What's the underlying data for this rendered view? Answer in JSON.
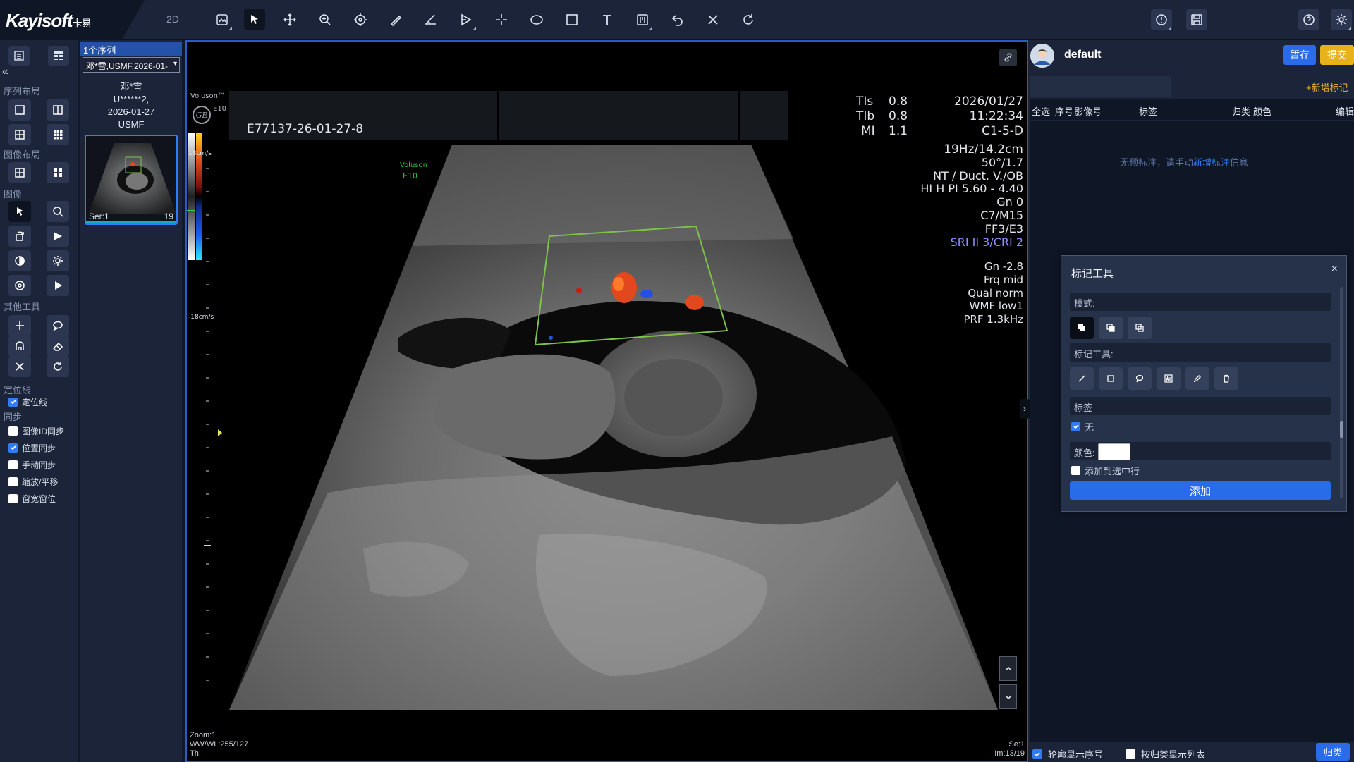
{
  "app": {
    "brand": "Kayisoft",
    "brand_cn": "卡易",
    "mode": "2D"
  },
  "toolbar": {
    "tools": [
      "image-view-icon",
      "pointer-icon",
      "pan-icon",
      "zoom-icon",
      "magnify-icon",
      "length-icon",
      "angle-icon",
      "arrow-icon",
      "crosshair-icon",
      "ellipse-icon",
      "rectangle-icon",
      "text-icon",
      "ruler-icon",
      "undo-icon",
      "delete-icon",
      "reset-icon"
    ],
    "right_tools": [
      "info-icon",
      "save-icon",
      "help-icon",
      "settings-icon"
    ]
  },
  "left_panel": {
    "series_layout_label": "序列布局",
    "image_layout_label": "图像布局",
    "image_label": "图像",
    "other_tools_label": "其他工具",
    "locator_section_label": "定位线",
    "locator_checkbox": "定位线",
    "sync_label": "同步",
    "sync_options": [
      {
        "label": "图像ID同步",
        "checked": false
      },
      {
        "label": "位置同步",
        "checked": true
      },
      {
        "label": "手动同步",
        "checked": false
      },
      {
        "label": "缩放/平移",
        "checked": false
      },
      {
        "label": "窗宽窗位",
        "checked": false
      }
    ]
  },
  "series_panel": {
    "tab": "1个序列",
    "select_value": "邓*雪,USMF,2026-01-",
    "patient_name": "邓*雪",
    "patient_id": "U******2,",
    "study_date": "2026-01-27",
    "modality": "USMF",
    "thumb_series": "Ser:1",
    "thumb_count": "19"
  },
  "viewport": {
    "device": "Voluson™",
    "device_model": "E10",
    "study_id": "E77137-26-01-27-8",
    "tis_label": "TIs",
    "tis_value": "0.8",
    "tib_label": "TIb",
    "tib_value": "0.8",
    "mi_label": "MI",
    "mi_value": "1.1",
    "date": "2026/01/27",
    "time": "11:22:34",
    "probe": "C1-5-D",
    "scan_params": [
      "19Hz/14.2cm",
      "50°/1.7",
      "NT / Duct. V./OB",
      "HI H PI 5.60 - 4.40",
      "Gn  0",
      "C7/M15",
      "FF3/E3"
    ],
    "scan_params_blue": "SRI II 3/CRI 2",
    "doppler_params": [
      "Gn -2.8",
      "Frq mid",
      "Qual norm",
      "WMF low1",
      "PRF  1.3kHz"
    ],
    "scale_top": "18cm/s",
    "scale_bottom": "-18cm/s",
    "watermark_1": "Voluson",
    "watermark_2": "E10",
    "zoom": "Zoom:1",
    "wwwl": "WW/WL:255/127",
    "th": "Th:",
    "se": "Se:1",
    "im": "Im:13/19"
  },
  "right_panel": {
    "user": "default",
    "save_label": "暂存",
    "submit_label": "提交",
    "add_mark_label": "+新增标记",
    "table_headers": {
      "select_all": "全选",
      "index": "序号",
      "image_no": "影像号",
      "label": "标签",
      "category": "归类",
      "color": "颜色",
      "edit": "编辑"
    },
    "empty_msg_before": "无预标注，请手动",
    "empty_msg_link": "新增标注",
    "empty_msg_after": "信息",
    "show_index_label": "轮廓显示序号",
    "show_index_checked": true,
    "by_category_label": "按归类显示列表",
    "by_category_checked": false,
    "classify_label": "归类"
  },
  "mark_dialog": {
    "title": "标记工具",
    "mode_label": "模式:",
    "tool_label": "标记工具:",
    "tag_label": "标签",
    "none_option": "无",
    "none_checked": true,
    "color_label": "颜色:",
    "color_value": "#ffffff",
    "add_to_row_label": "添加到选中行",
    "add_to_row_checked": false,
    "add_button": "添加"
  },
  "colors": {
    "accent": "#2a6bea",
    "submit": "#e8b31a",
    "add_mark": "#f0b32c",
    "link": "#2e7cf6",
    "roi_box": "#7fc24a"
  }
}
